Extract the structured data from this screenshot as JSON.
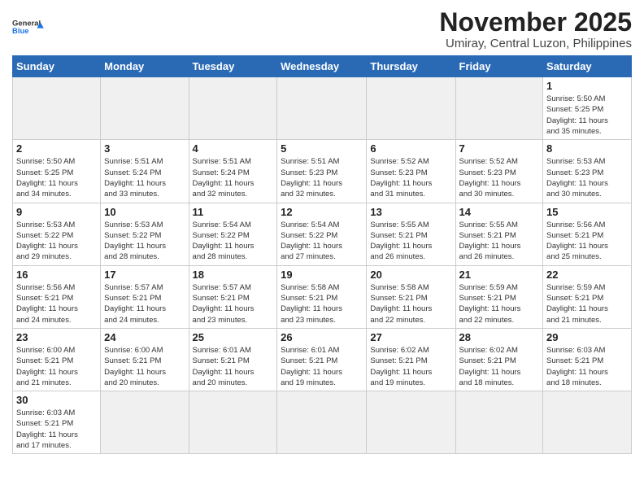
{
  "header": {
    "logo_general": "General",
    "logo_blue": "Blue",
    "month": "November 2025",
    "location": "Umiray, Central Luzon, Philippines"
  },
  "weekdays": [
    "Sunday",
    "Monday",
    "Tuesday",
    "Wednesday",
    "Thursday",
    "Friday",
    "Saturday"
  ],
  "weeks": [
    [
      {
        "day": null,
        "info": ""
      },
      {
        "day": null,
        "info": ""
      },
      {
        "day": null,
        "info": ""
      },
      {
        "day": null,
        "info": ""
      },
      {
        "day": null,
        "info": ""
      },
      {
        "day": null,
        "info": ""
      },
      {
        "day": "1",
        "info": "Sunrise: 5:50 AM\nSunset: 5:25 PM\nDaylight: 11 hours\nand 35 minutes."
      }
    ],
    [
      {
        "day": "2",
        "info": "Sunrise: 5:50 AM\nSunset: 5:25 PM\nDaylight: 11 hours\nand 34 minutes."
      },
      {
        "day": "3",
        "info": "Sunrise: 5:51 AM\nSunset: 5:24 PM\nDaylight: 11 hours\nand 33 minutes."
      },
      {
        "day": "4",
        "info": "Sunrise: 5:51 AM\nSunset: 5:24 PM\nDaylight: 11 hours\nand 32 minutes."
      },
      {
        "day": "5",
        "info": "Sunrise: 5:51 AM\nSunset: 5:23 PM\nDaylight: 11 hours\nand 32 minutes."
      },
      {
        "day": "6",
        "info": "Sunrise: 5:52 AM\nSunset: 5:23 PM\nDaylight: 11 hours\nand 31 minutes."
      },
      {
        "day": "7",
        "info": "Sunrise: 5:52 AM\nSunset: 5:23 PM\nDaylight: 11 hours\nand 30 minutes."
      },
      {
        "day": "8",
        "info": "Sunrise: 5:53 AM\nSunset: 5:23 PM\nDaylight: 11 hours\nand 30 minutes."
      }
    ],
    [
      {
        "day": "9",
        "info": "Sunrise: 5:53 AM\nSunset: 5:22 PM\nDaylight: 11 hours\nand 29 minutes."
      },
      {
        "day": "10",
        "info": "Sunrise: 5:53 AM\nSunset: 5:22 PM\nDaylight: 11 hours\nand 28 minutes."
      },
      {
        "day": "11",
        "info": "Sunrise: 5:54 AM\nSunset: 5:22 PM\nDaylight: 11 hours\nand 28 minutes."
      },
      {
        "day": "12",
        "info": "Sunrise: 5:54 AM\nSunset: 5:22 PM\nDaylight: 11 hours\nand 27 minutes."
      },
      {
        "day": "13",
        "info": "Sunrise: 5:55 AM\nSunset: 5:21 PM\nDaylight: 11 hours\nand 26 minutes."
      },
      {
        "day": "14",
        "info": "Sunrise: 5:55 AM\nSunset: 5:21 PM\nDaylight: 11 hours\nand 26 minutes."
      },
      {
        "day": "15",
        "info": "Sunrise: 5:56 AM\nSunset: 5:21 PM\nDaylight: 11 hours\nand 25 minutes."
      }
    ],
    [
      {
        "day": "16",
        "info": "Sunrise: 5:56 AM\nSunset: 5:21 PM\nDaylight: 11 hours\nand 24 minutes."
      },
      {
        "day": "17",
        "info": "Sunrise: 5:57 AM\nSunset: 5:21 PM\nDaylight: 11 hours\nand 24 minutes."
      },
      {
        "day": "18",
        "info": "Sunrise: 5:57 AM\nSunset: 5:21 PM\nDaylight: 11 hours\nand 23 minutes."
      },
      {
        "day": "19",
        "info": "Sunrise: 5:58 AM\nSunset: 5:21 PM\nDaylight: 11 hours\nand 23 minutes."
      },
      {
        "day": "20",
        "info": "Sunrise: 5:58 AM\nSunset: 5:21 PM\nDaylight: 11 hours\nand 22 minutes."
      },
      {
        "day": "21",
        "info": "Sunrise: 5:59 AM\nSunset: 5:21 PM\nDaylight: 11 hours\nand 22 minutes."
      },
      {
        "day": "22",
        "info": "Sunrise: 5:59 AM\nSunset: 5:21 PM\nDaylight: 11 hours\nand 21 minutes."
      }
    ],
    [
      {
        "day": "23",
        "info": "Sunrise: 6:00 AM\nSunset: 5:21 PM\nDaylight: 11 hours\nand 21 minutes."
      },
      {
        "day": "24",
        "info": "Sunrise: 6:00 AM\nSunset: 5:21 PM\nDaylight: 11 hours\nand 20 minutes."
      },
      {
        "day": "25",
        "info": "Sunrise: 6:01 AM\nSunset: 5:21 PM\nDaylight: 11 hours\nand 20 minutes."
      },
      {
        "day": "26",
        "info": "Sunrise: 6:01 AM\nSunset: 5:21 PM\nDaylight: 11 hours\nand 19 minutes."
      },
      {
        "day": "27",
        "info": "Sunrise: 6:02 AM\nSunset: 5:21 PM\nDaylight: 11 hours\nand 19 minutes."
      },
      {
        "day": "28",
        "info": "Sunrise: 6:02 AM\nSunset: 5:21 PM\nDaylight: 11 hours\nand 18 minutes."
      },
      {
        "day": "29",
        "info": "Sunrise: 6:03 AM\nSunset: 5:21 PM\nDaylight: 11 hours\nand 18 minutes."
      }
    ],
    [
      {
        "day": "30",
        "info": "Sunrise: 6:03 AM\nSunset: 5:21 PM\nDaylight: 11 hours\nand 17 minutes."
      },
      {
        "day": null,
        "info": ""
      },
      {
        "day": null,
        "info": ""
      },
      {
        "day": null,
        "info": ""
      },
      {
        "day": null,
        "info": ""
      },
      {
        "day": null,
        "info": ""
      },
      {
        "day": null,
        "info": ""
      }
    ]
  ]
}
